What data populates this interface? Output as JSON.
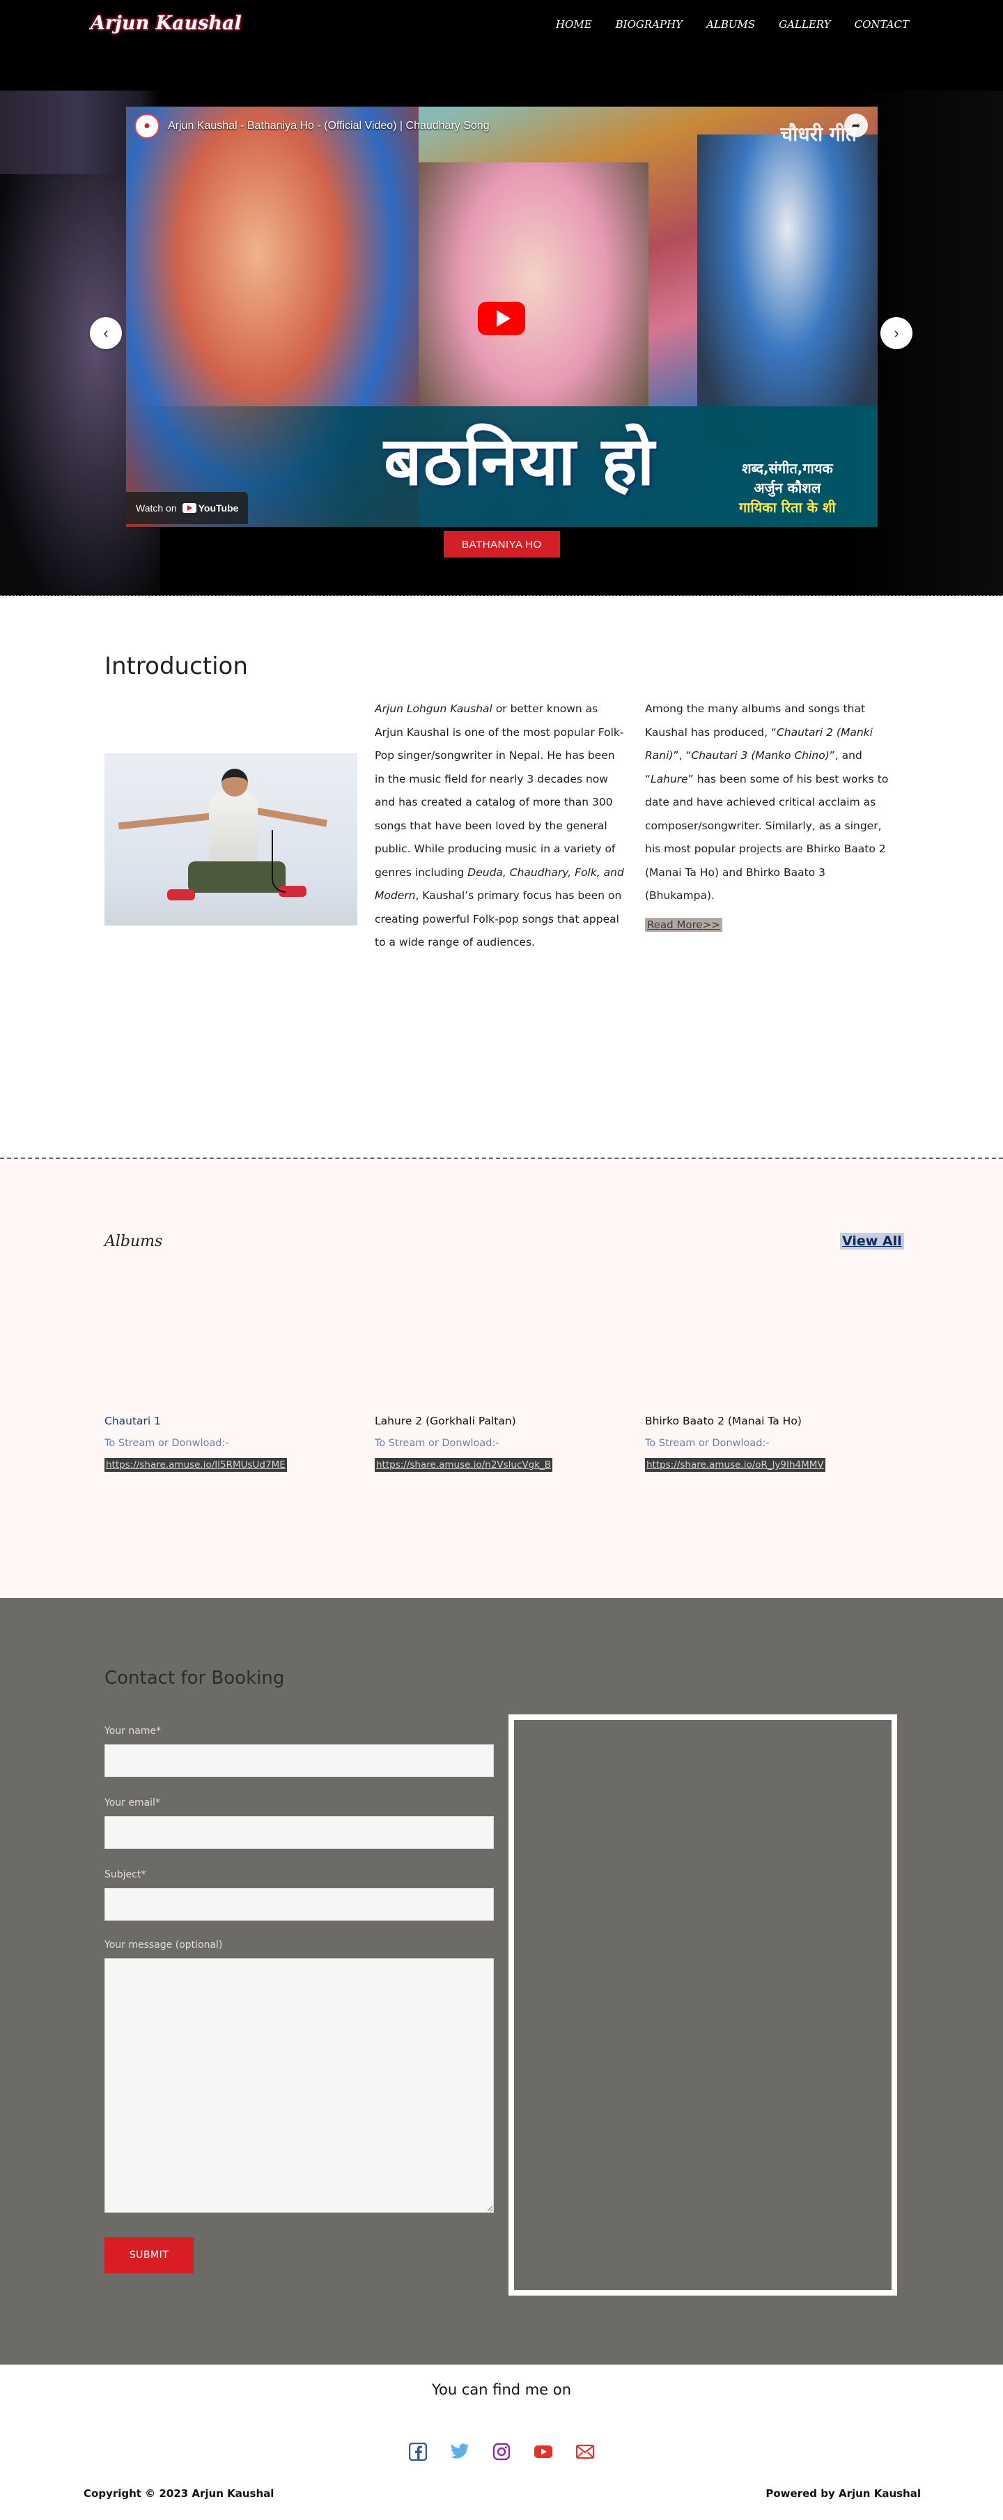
{
  "header": {
    "logo": "Arjun Kaushal",
    "nav": [
      "HOME",
      "BIOGRAPHY",
      "ALBUMS",
      "GALLERY",
      "CONTACT"
    ]
  },
  "hero": {
    "video": {
      "title": "Arjun Kaushal - Bathaniya Ho - (Official Video) | Chaudhary Song",
      "channel_mark": "चौधरी गीत",
      "overlay_title": "बठनिया हो",
      "credits_line1": "शब्द,संगीत,गायक",
      "credits_line2": "अर्जुन कौशल",
      "credits_line3": "गायिका रिता के शी",
      "watch_on": "Watch on",
      "youtube": "YouTube"
    },
    "prev_arrow": "‹",
    "next_arrow": "›",
    "caption_button": "BATHANIYA HO"
  },
  "intro": {
    "heading": "Introduction",
    "col1": {
      "name": "Arjun Lohgun Kaushal",
      "text1": " or better known as Arjun Kaushal is one of the most popular Folk-Pop singer/songwriter in Nepal. He has been in the music field for nearly 3 decades now and has created a catalog of more than 300 songs that have been loved by the general public. While producing music in a variety of genres including ",
      "genres": "Deuda, Chaudhary, Folk, and Modern",
      "text2": ", Kaushal’s primary focus has been on creating powerful Folk-pop songs that appeal to a wide range of audiences."
    },
    "col2": {
      "text1": "Among the many albums and songs that Kaushal has produced, “",
      "album1": "Chautari 2 (Manki Rani)",
      "sep1": "”, “",
      "album2": "Chautari 3 (Manko Chino)",
      "sep2": "”, and “",
      "album3": "Lahure",
      "text2": "” has been some of his best works to date and have achieved critical acclaim as composer/songwriter. Similarly, as a singer, his most popular projects are Bhirko Baato 2 (Manai Ta Ho) and Bhirko Baato 3 (Bhukampa).",
      "read_more": "Read More>>"
    }
  },
  "albums": {
    "heading": "Albums",
    "view_all": "View All",
    "items": [
      {
        "title": "Chautari 1",
        "stream": "To Stream or Donwload:-",
        "link": "https://share.amuse.io/Il5RMUsUd7ME"
      },
      {
        "title": "Lahure 2 (Gorkhali Paltan)",
        "stream": "To Stream or Donwload:-",
        "link": "https://share.amuse.io/n2VslucVgk_B"
      },
      {
        "title": "Bhirko Baato 2 (Manai Ta Ho)",
        "stream": "To Stream or Donwload:-",
        "link": "https://share.amuse.io/oR_ly9Ih4MMV"
      }
    ]
  },
  "contact": {
    "heading": "Contact for Booking",
    "name_label": "Your name*",
    "email_label": "Your email*",
    "subject_label": "Subject*",
    "message_label": "Your message (optional)",
    "submit": "SUBMIT"
  },
  "footer": {
    "find_me": "You can find me on",
    "social_icons": [
      "facebook-icon",
      "twitter-icon",
      "instagram-icon",
      "youtube-icon",
      "mail-icon"
    ],
    "copyright": "Copyright © 2023 Arjun Kaushal",
    "powered_by": "Powered by Arjun Kaushal"
  },
  "colors": {
    "accent_red": "#d41f26",
    "hero_bg": "#000000",
    "albums_bg": "#fff7f5",
    "contact_bg": "#6d6b68"
  }
}
